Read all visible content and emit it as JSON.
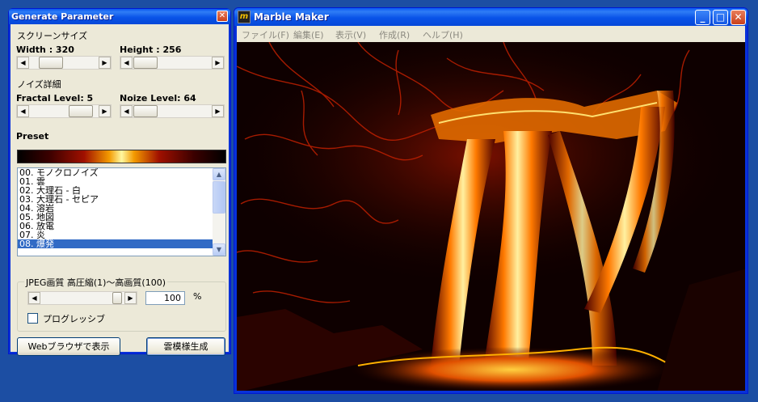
{
  "param_window": {
    "title": "Generate Parameter",
    "close_glyph": "✕",
    "screen_size_label": "スクリーンサイズ",
    "width_label": "Width : 320",
    "height_label": "Height : 256",
    "noise_detail_label": "ノイズ詳細",
    "fractal_label": "Fractal Level: 5",
    "noize_label": "Noize Level: 64",
    "preset_label": "Preset",
    "preset_items": [
      "00. モノクロノイズ",
      "01. 雲",
      "02. 大理石 - 白",
      "03. 大理石 - セピア",
      "04. 溶岩",
      "05. 地図",
      "06. 放電",
      "07. 炎",
      "08. 爆発"
    ],
    "selected_preset": "08. 爆発",
    "jpeg_group_title": "JPEG画質 高圧縮(1)〜高画質(100)",
    "jpeg_quality": "100",
    "percent_label": "%",
    "progressive_label": "プログレッシブ",
    "progressive_checked": false,
    "browser_button": "Webブラウザで表示",
    "generate_button": "雲模様生成"
  },
  "main_window": {
    "title": "Marble Maker",
    "icon_glyph": "m",
    "menu": [
      "ファイル(F)",
      "編集(E)",
      "表示(V)",
      "作成(R)",
      "ヘルプ(H)"
    ],
    "min_glyph": "_",
    "max_glyph": "□",
    "close_glyph": "✕"
  },
  "scroll_glyphs": {
    "left": "◀",
    "right": "▶",
    "up": "▲",
    "down": "▼"
  },
  "colors": {
    "title_blue": "#0a58f0",
    "selection_blue": "#316ac5",
    "lava_orange": "#ff8a00",
    "lava_red": "#a01000"
  }
}
